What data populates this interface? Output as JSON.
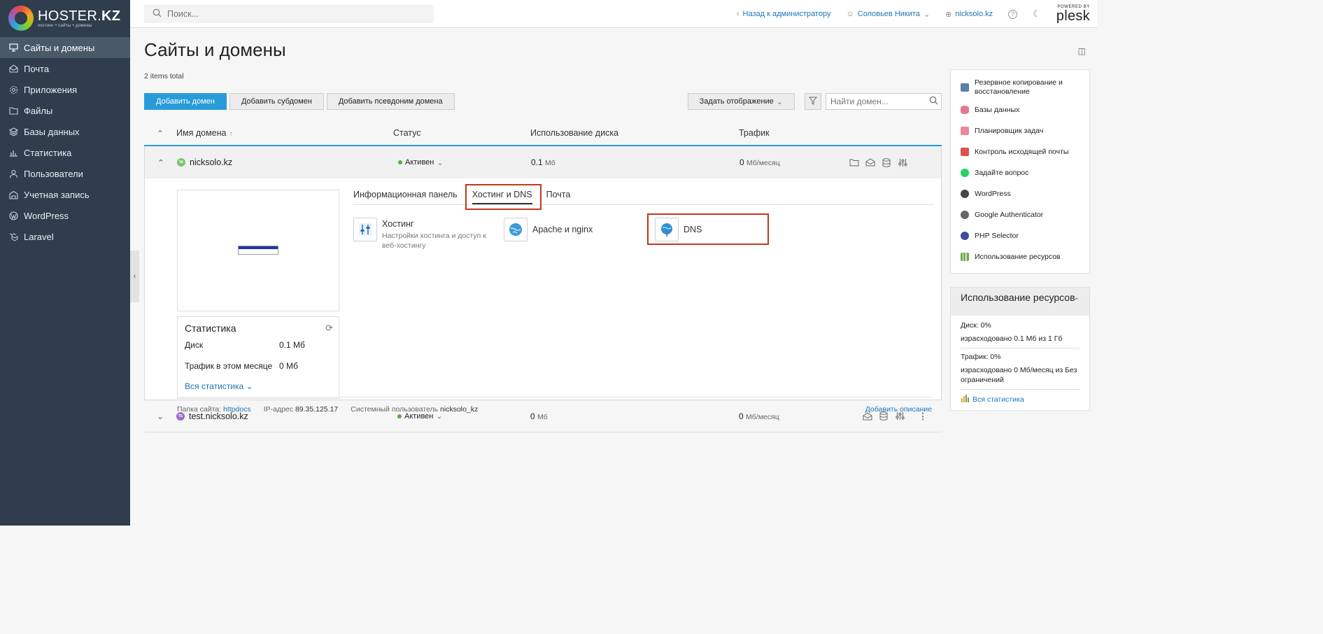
{
  "logo": {
    "brand": "HOSTER.",
    "brand_bold": "KZ",
    "tagline": "хостинг • сайты • домены"
  },
  "sidebar": {
    "items": [
      {
        "label": "Сайты и домены",
        "icon": "monitor-icon",
        "active": true
      },
      {
        "label": "Почта",
        "icon": "mail-icon"
      },
      {
        "label": "Приложения",
        "icon": "gear-icon"
      },
      {
        "label": "Файлы",
        "icon": "folder-icon"
      },
      {
        "label": "Базы данных",
        "icon": "layers-icon"
      },
      {
        "label": "Статистика",
        "icon": "bar-chart-icon"
      },
      {
        "label": "Пользователи",
        "icon": "user-icon"
      },
      {
        "label": "Учетная запись",
        "icon": "account-icon"
      },
      {
        "label": "WordPress",
        "icon": "wordpress-icon"
      },
      {
        "label": "Laravel",
        "icon": "laravel-icon"
      }
    ]
  },
  "topbar": {
    "search_placeholder": "Поиск...",
    "back_link": "Назад к администратору",
    "user": "Соловьев Никита",
    "domain": "nicksolo.kz",
    "powered_by": "POWERED BY",
    "plesk": "plesk"
  },
  "page": {
    "title": "Сайты и домены",
    "items_total": "2 items total"
  },
  "toolbar": {
    "add_domain": "Добавить домен",
    "add_subdomain": "Добавить субдомен",
    "add_alias": "Добавить псевдоним домена",
    "view_mode": "Задать отображение",
    "search_placeholder": "Найти домен..."
  },
  "table": {
    "headers": {
      "name": "Имя домена",
      "status": "Статус",
      "disk": "Использование диска",
      "traffic": "Трафик"
    }
  },
  "domains": [
    {
      "name": "nicksolo.kz",
      "status": "Активен",
      "disk_value": "0.1",
      "disk_unit": "Мб",
      "traffic_value": "0",
      "traffic_unit": "Мб/месяц",
      "favicon_text": "NI",
      "favicon_color": "#7ac56e"
    },
    {
      "name": "test.nicksolo.kz",
      "status": "Активен",
      "disk_value": "0",
      "disk_unit": "Мб",
      "traffic_value": "0",
      "traffic_unit": "Мб/месяц",
      "favicon_text": "TE",
      "favicon_color": "#9b6ec9"
    }
  ],
  "expanded": {
    "tabs": [
      "Информационная панель",
      "Хостинг и DNS",
      "Почта"
    ],
    "active_tab": 1,
    "tiles": {
      "hosting_title": "Хостинг",
      "hosting_sub": "Настройки хостинга и доступ к веб-хостингу",
      "apache_title": "Apache и nginx",
      "dns_title": "DNS"
    },
    "stats": {
      "title": "Статистика",
      "disk_label": "Диск",
      "disk_value": "0.1 Мб",
      "traffic_label": "Трафик в этом месяце",
      "traffic_value": "0 Мб",
      "all_link": "Вся статистика"
    },
    "footer": {
      "folder_label": "Папка сайта:",
      "folder_value": "httpdocs",
      "ip_label": "IP-адрес",
      "ip_value": "89.35.125.17",
      "sysuser_label": "Системный пользователь",
      "sysuser_value": "nicksolo_kz",
      "add_description": "Добавить описание"
    }
  },
  "right_panel": {
    "items": [
      {
        "label": "Резервное копирование и восстановление",
        "color": "#5a7fa8"
      },
      {
        "label": "Базы данных",
        "color": "#e07a8a"
      },
      {
        "label": "Планировщик задач",
        "color": "#e8899a"
      },
      {
        "label": "Контроль исходящей почты",
        "color": "#d9534f"
      },
      {
        "label": "Задайте вопрос",
        "color": "#25d366"
      },
      {
        "label": "WordPress",
        "color": "#464646"
      },
      {
        "label": "Google Authenticator",
        "color": "#666666"
      },
      {
        "label": "PHP Selector",
        "color": "#3b4f9c"
      },
      {
        "label": "Использование ресурсов",
        "color": "#6fa84f"
      }
    ]
  },
  "usage": {
    "title": "Использование ресурсов",
    "disk_label": "Диск: 0%",
    "disk_detail": "израсходовано 0.1 Мб из 1 Гб",
    "traffic_label": "Трафик: 0%",
    "traffic_detail": "израсходовано 0 Мб/месяц из Без ограничений",
    "all_link": "Вся статистика"
  }
}
